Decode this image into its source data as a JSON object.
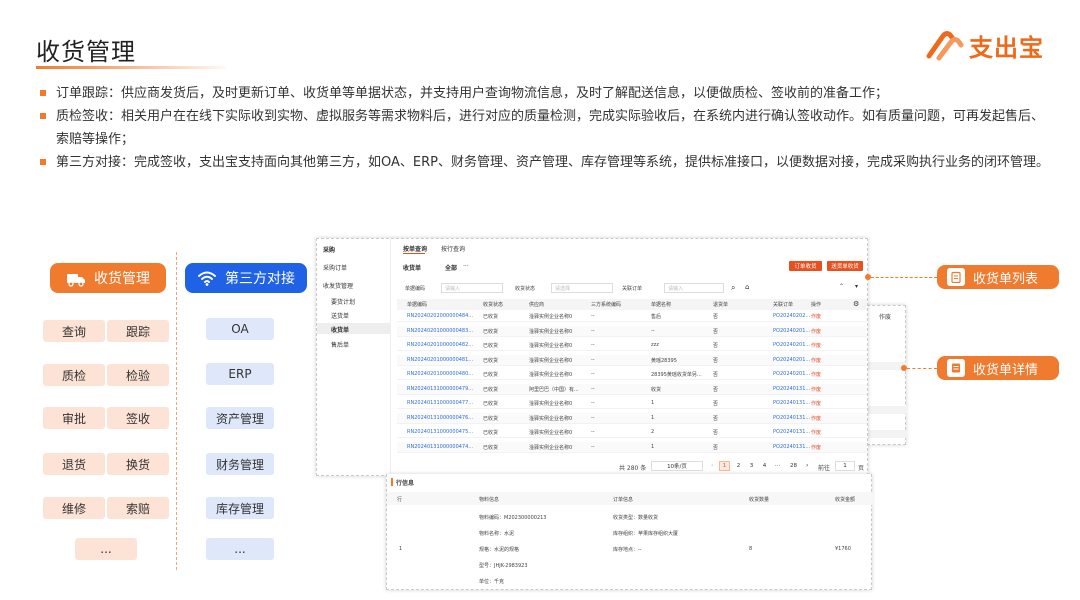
{
  "header": {
    "title": "收货管理",
    "logo_text": "支出宝"
  },
  "bullets": [
    "订单跟踪：供应商发货后，及时更新订单、收货单等单据状态，并支持用户查询物流信息，及时了解配送信息，以便做质检、签收前的准备工作；",
    "质检签收：相关用户在在线下实际收到实物、虚拟服务等需求物料后，进行对应的质量检测，完成实际验收后，在系统内进行确认签收动作。如有质量问题，可再发起售后、索赔等操作；",
    "第三方对接：完成签收，支出宝支持面向其他第三方，如OA、ERP、财务管理、资产管理、库存管理等系统，提供标准接口，以便数据对接，完成采购执行业务的闭环管理。"
  ],
  "left_panel": {
    "title": "收货管理",
    "chips": [
      "查询",
      "跟踪",
      "质检",
      "检验",
      "审批",
      "签收",
      "退货",
      "换货",
      "维修",
      "索赔",
      "..."
    ]
  },
  "right_panel": {
    "title": "第三方对接",
    "chips": [
      "OA",
      "ERP",
      "资产管理",
      "财务管理",
      "库存管理",
      "..."
    ]
  },
  "ribbons": {
    "list": "收货单列表",
    "detail": "收货单详情"
  },
  "colors": {
    "accent": "#f07b2f",
    "blue": "#1f62e6",
    "link": "#2f6fd8",
    "danger": "#e84e2c"
  },
  "app": {
    "sidebar": {
      "header": "采购",
      "items": [
        {
          "label": "采购订单"
        },
        {
          "label": "收发货管理"
        },
        {
          "label": "要货计划"
        },
        {
          "label": "送货单"
        },
        {
          "label": "收货单"
        },
        {
          "label": "售后单"
        }
      ]
    },
    "top_tabs": [
      "按单查询",
      "按行查询"
    ],
    "sub_tab": "收货单",
    "filter_tabs": {
      "all": "全部",
      "more": "···"
    },
    "buttons": {
      "receive": "订单收货",
      "receive_by_sheet": "送货单收货"
    },
    "filters": [
      {
        "label": "单据编码",
        "placeholder": "请输入"
      },
      {
        "label": "收货状态",
        "placeholder": "请选择"
      },
      {
        "label": "关联订单",
        "placeholder": "请输入"
      }
    ],
    "columns": [
      "单据编码",
      "收货状态",
      "供应商",
      "三方系统编码",
      "单据名称",
      "退货单",
      "关联订单",
      "操作"
    ],
    "rows": [
      [
        "RN20240202000000484...",
        "已收货",
        "淦驿实例企业名称0",
        "--",
        "售后",
        "否",
        "PO20240202...",
        "作废"
      ],
      [
        "RN20240201000000483...",
        "已收货",
        "淦驿实例企业名称0",
        "--",
        "--",
        "否",
        "PO20240201...",
        "作废"
      ],
      [
        "RN20240201000000482...",
        "已收货",
        "淦驿实例企业名称0",
        "--",
        "zzz",
        "否",
        "PO20240201...",
        "作废"
      ],
      [
        "RN20240201000000481...",
        "已收货",
        "淦驿实例企业名称0",
        "--",
        "黄瑶28395",
        "否",
        "PO20240201...",
        "作废"
      ],
      [
        "RN20240201000000480...",
        "已收货",
        "淦驿实例企业名称0",
        "--",
        "28395黄瑶收货单另...",
        "否",
        "PO20240201...",
        "作废"
      ],
      [
        "RN20240131000000479...",
        "已收货",
        "阿里巴巴（中国）有...",
        "--",
        "收货",
        "否",
        "PO20240131...",
        "作废"
      ],
      [
        "RN20240131000000477...",
        "已收货",
        "淦驿实例企业名称0",
        "--",
        "1",
        "否",
        "PO20240131...",
        "作废"
      ],
      [
        "RN20240131000000476...",
        "已收货",
        "淦驿实例企业名称0",
        "--",
        "1",
        "否",
        "PO20240131...",
        "作废"
      ],
      [
        "RN20240131000000475...",
        "已收货",
        "淦驿实例企业名称0",
        "--",
        "2",
        "否",
        "PO20240131...",
        "作废"
      ],
      [
        "RN20240131000000474...",
        "已收货",
        "淦驿实例企业名称0",
        "--",
        "1",
        "否",
        "PO20240131...",
        "作废"
      ]
    ],
    "pagination": {
      "total": "共 280 条",
      "page_size": "10条/页",
      "pages": [
        "1",
        "2",
        "3",
        "4",
        "···",
        "28"
      ],
      "goto_label": "前往",
      "goto_value": "1",
      "page_suffix": "页"
    }
  },
  "detail": {
    "section_title": "行信息",
    "behind_label": "作废",
    "columns": [
      "行",
      "物料信息",
      "订单信息",
      "收货数量",
      "收货金额"
    ],
    "row": {
      "line": "1",
      "material": [
        "物料编码：M202300000213",
        "物料名称：水泥",
        "规格：水泥的规格",
        "型号：JHJK-2983923",
        "单位：千克"
      ],
      "order": [
        "收货类型：数量收货",
        "库存组织：苹果库存组织大厦",
        "库存地点：--"
      ],
      "qty": "8",
      "amount": "¥1760"
    }
  }
}
